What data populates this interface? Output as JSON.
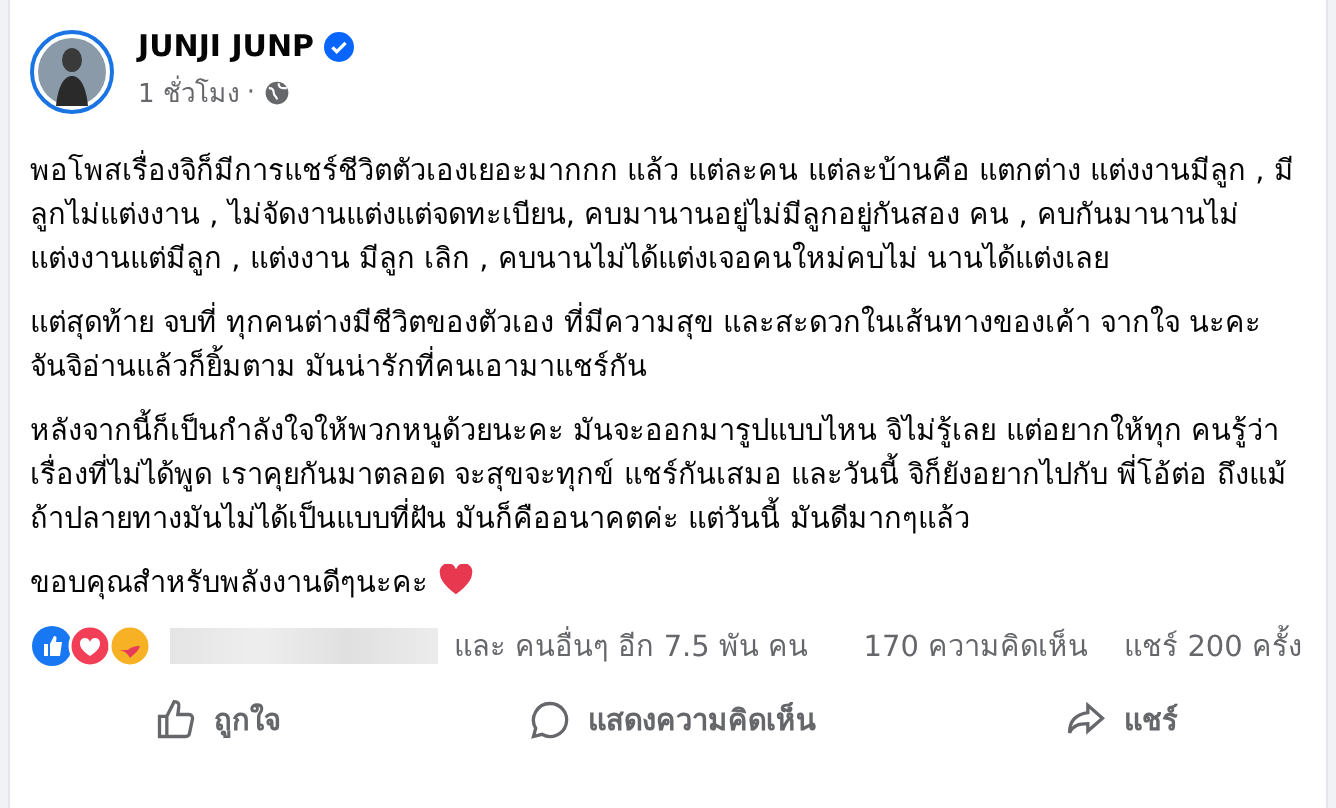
{
  "post": {
    "author": "JUNJI JUNP",
    "verified": true,
    "time": "1 ชั่วโมง",
    "separator": "·",
    "paragraphs": [
      "พอโพสเรื่องจิก็มีการแชร์ชีวิตตัวเองเยอะมากกก แล้ว แต่ละคน แต่ละบ้านคือ แตกต่าง แต่งงานมีลูก , มีลูกไม่แต่งงาน , ไม่จัดงานแต่งแต่จดทะเบียน, คบมานานอยู่ไม่มีลูกอยู่กันสอง คน , คบกันมานานไม่แต่งงานแต่มีลูก , แต่งงาน มีลูก เลิก , คบนานไม่ได้แต่งเจอคนใหม่คบไม่ นานได้แต่งเลย",
      "แต่สุดท้าย จบที่ ทุกคนต่างมีชีวิตของตัวเอง ที่มีความสุข และสะดวกในเส้นทางของเค้า จากใจ นะคะ จันจิอ่านแล้วก็ยิ้มตาม มันน่ารักที่คนเอามาแชร์กัน",
      "หลังจากนี้ก็เป็นกำลังใจให้พวกหนูด้วยนะคะ มันจะออกมารูปแบบไหน จิไม่รู้เลย แต่อยากให้ทุก คนรู้ว่าเรื่องที่ไม่ได้พูด เราคุยกันมาตลอด จะสุขจะทุกข์ แชร์กันเสมอ และวันนี้ จิก็ยังอยากไปกับ พี่โอ้ต่อ ถึงแม้ถ้าปลายทางมันไม่ได้เป็นแบบที่ฝัน มันก็คืออนาคตค่ะ แต่วันนี้ มันดีมากๆแล้ว",
      "ขอบคุณสำหรับพลังงานดีๆนะคะ"
    ]
  },
  "reactions": {
    "others": "และ คนอื่นๆ อีก 7.5 พัน คน",
    "comments": "170 ความคิดเห็น",
    "shares": "แชร์ 200 ครั้ง"
  },
  "actions": [
    {
      "kind": "like",
      "label": "ถูกใจ"
    },
    {
      "kind": "comment",
      "label": "แสดงความคิดเห็น"
    },
    {
      "kind": "share",
      "label": "แชร์"
    }
  ]
}
